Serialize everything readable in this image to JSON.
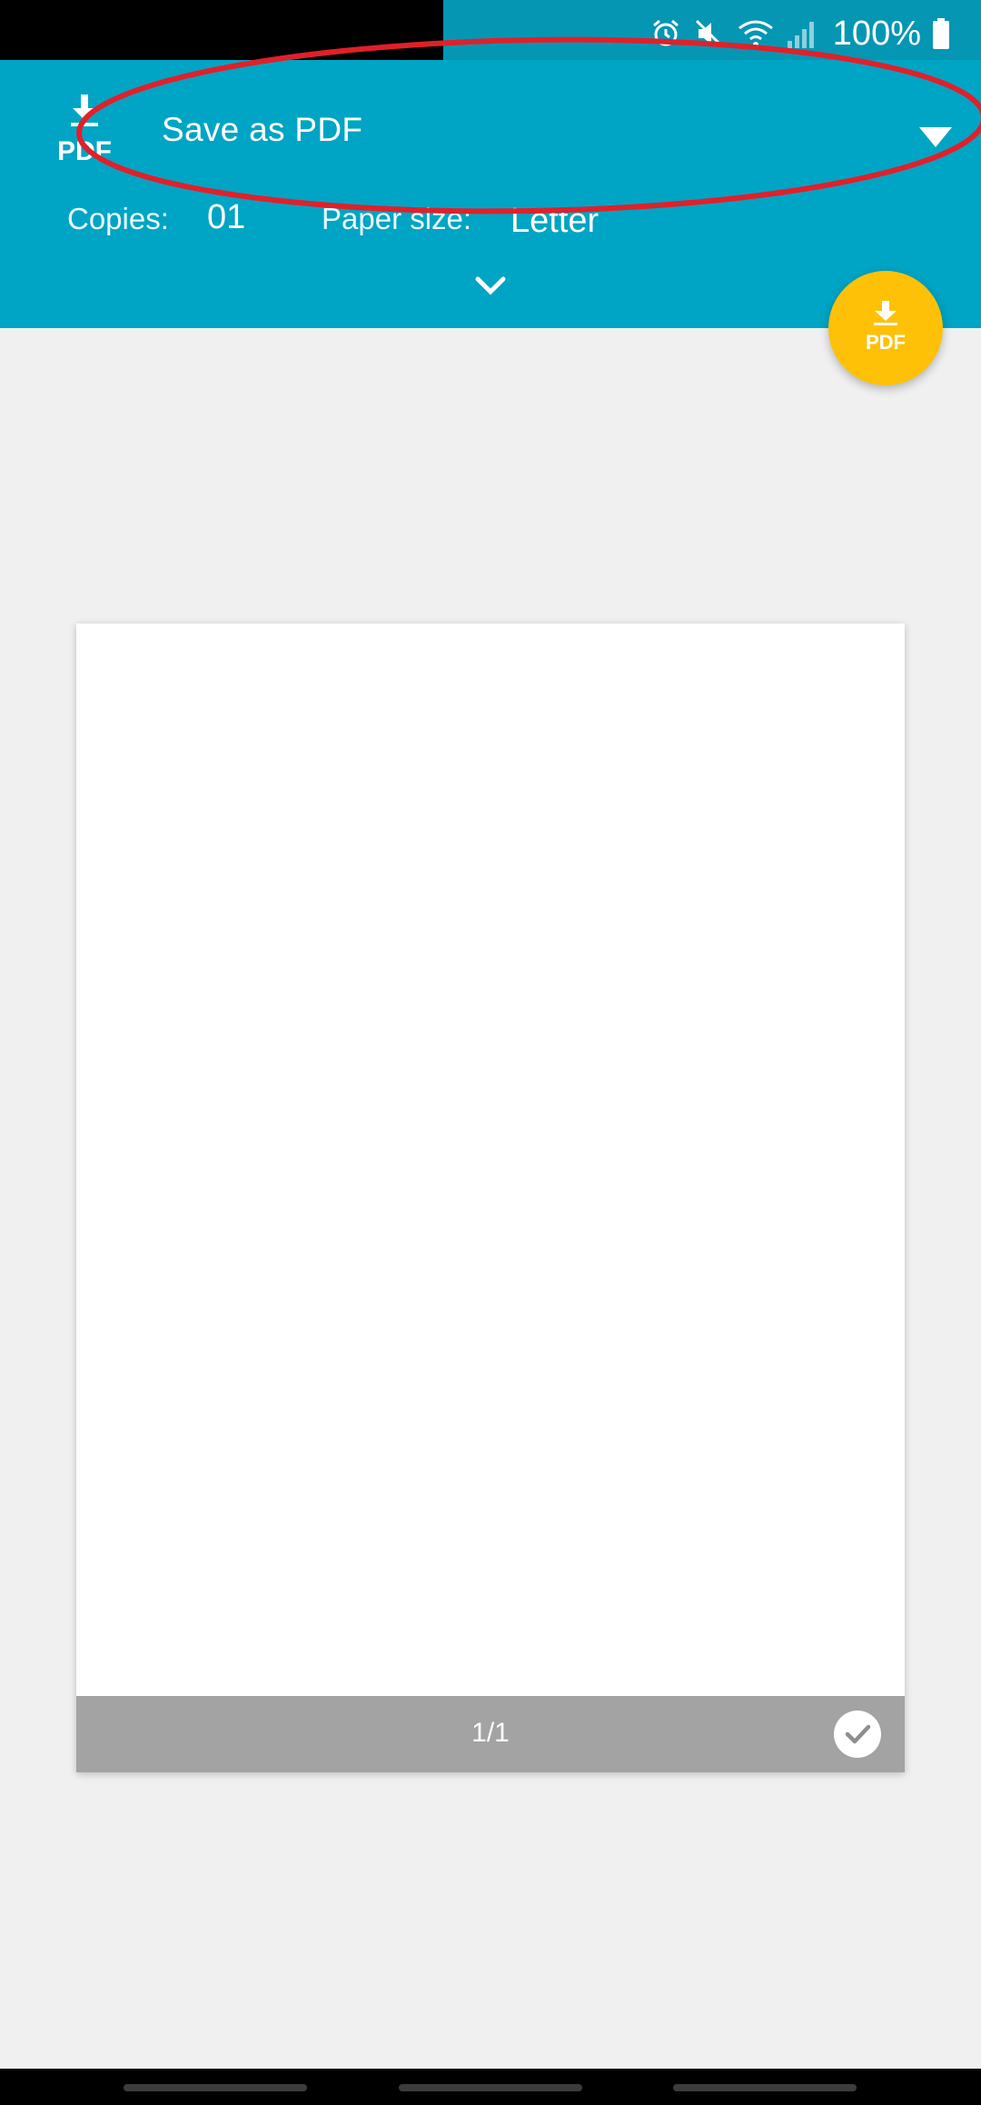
{
  "status_bar": {
    "battery_percent": "100%",
    "icons": [
      "alarm-icon",
      "mute-icon",
      "wifi-icon",
      "signal-icon",
      "battery-icon"
    ]
  },
  "header": {
    "pdf_icon_label": "PDF",
    "printer_name": "Save as PDF",
    "copies_label": "Copies:",
    "copies_value": "01",
    "paper_size_label": "Paper size:",
    "paper_size_value": "Letter",
    "background_color": "#00a4c4"
  },
  "fab": {
    "label": "PDF",
    "icon": "download-pdf-icon",
    "color": "#ffc107"
  },
  "preview": {
    "page_indicator": "1/1",
    "selected": true
  },
  "annotation": {
    "highlight_color": "#e0202a"
  }
}
